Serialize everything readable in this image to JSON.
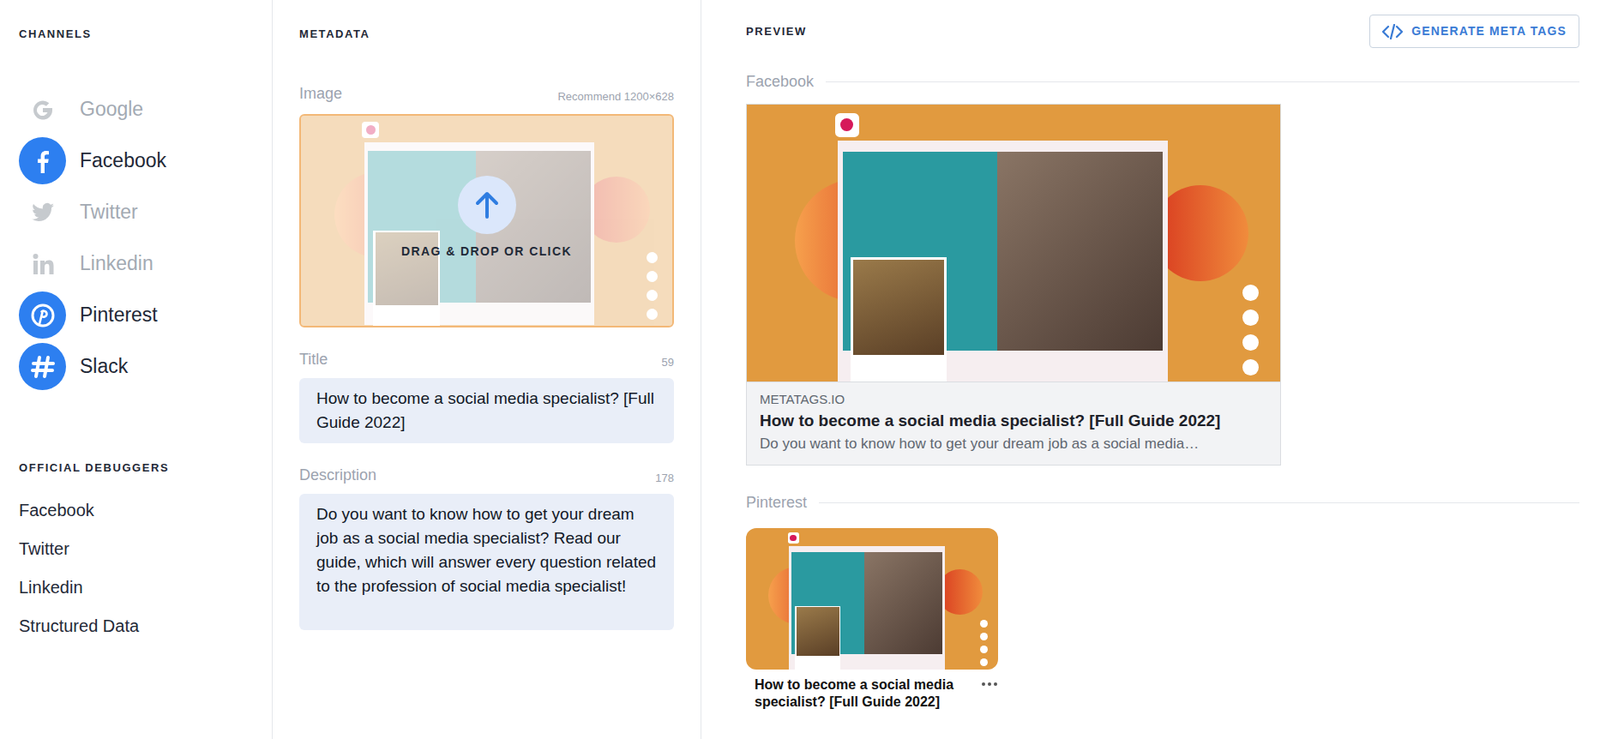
{
  "channels": {
    "heading": "CHANNELS",
    "items": [
      {
        "label": "Google",
        "selected": false
      },
      {
        "label": "Facebook",
        "selected": true
      },
      {
        "label": "Twitter",
        "selected": false
      },
      {
        "label": "Linkedin",
        "selected": false
      },
      {
        "label": "Pinterest",
        "selected": true
      },
      {
        "label": "Slack",
        "selected": true
      }
    ]
  },
  "debuggers": {
    "heading": "OFFICIAL DEBUGGERS",
    "items": [
      "Facebook",
      "Twitter",
      "Linkedin",
      "Structured Data"
    ]
  },
  "metadata": {
    "heading": "METADATA",
    "image": {
      "label": "Image",
      "hint": "Recommend 1200×628",
      "upload": "DRAG & DROP OR CLICK"
    },
    "title": {
      "label": "Title",
      "count": "59",
      "value": "How to become a social media specialist? [Full Guide 2022]"
    },
    "description": {
      "label": "Description",
      "count": "178",
      "value": "Do you want to know how to get your dream job as a social media specialist? Read our guide, which will answer every question related to the profession of social media specialist!"
    }
  },
  "preview": {
    "heading": "PREVIEW",
    "button": "GENERATE META TAGS",
    "facebook": {
      "label": "Facebook",
      "domain": "METATAGS.IO",
      "title": "How to become a social media specialist? [Full Guide 2022]",
      "description": "Do you want to know how to get your dream job as a social media…"
    },
    "pinterest": {
      "label": "Pinterest",
      "title": "How to become a social media specialist? [Full Guide 2022]"
    }
  }
}
